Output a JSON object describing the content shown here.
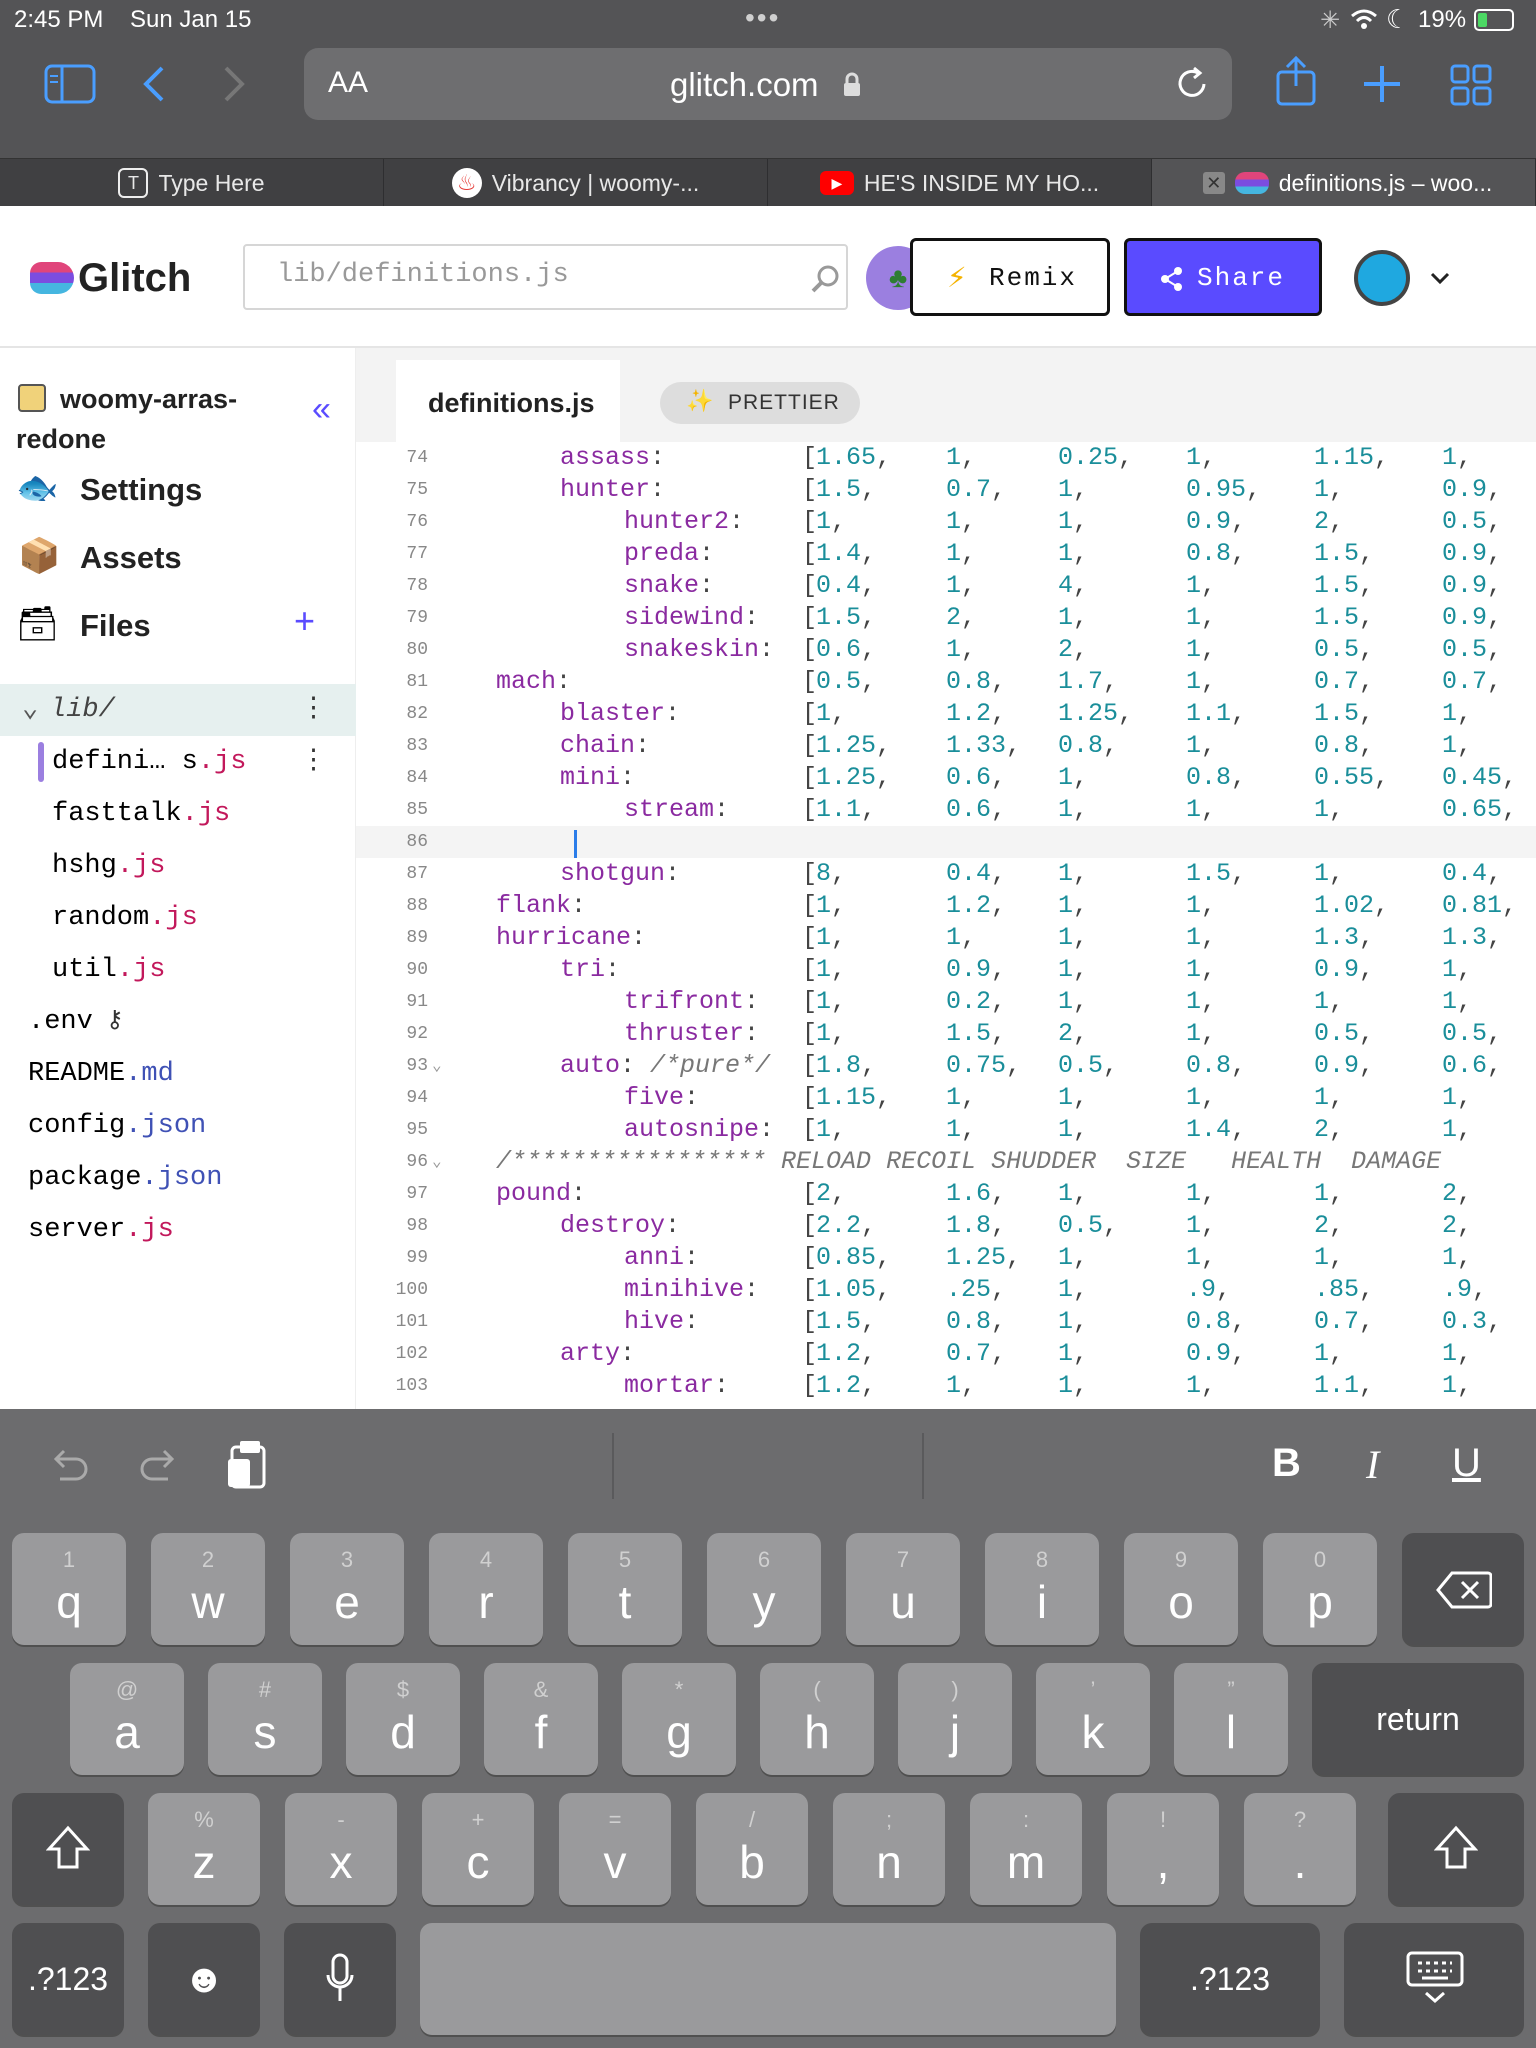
{
  "status": {
    "time": "2:45 PM",
    "date": "Sun Jan 15",
    "battery": "19%"
  },
  "browser": {
    "text_size": "AA",
    "url": "glitch.com"
  },
  "tabs": [
    {
      "title": "Type Here"
    },
    {
      "title": "Vibrancy | woomy-..."
    },
    {
      "title": "HE'S INSIDE MY HO..."
    },
    {
      "title": "definitions.js – woo..."
    }
  ],
  "header": {
    "brand": "Glitch",
    "search_value": "lib/definitions.js",
    "remix_label": "Remix",
    "share_label": "Share"
  },
  "sidebar": {
    "project_line1": "woomy-arras-",
    "project_line2": "redone",
    "settings": "Settings",
    "assets": "Assets",
    "files": "Files",
    "folder": "lib/",
    "files_list": [
      {
        "name": "defini… s",
        "ext": ".js"
      },
      {
        "name": "fasttalk",
        "ext": ".js"
      },
      {
        "name": "hshg",
        "ext": ".js"
      },
      {
        "name": "random",
        "ext": ".js"
      },
      {
        "name": "util",
        "ext": ".js"
      },
      {
        "name": ".env",
        "ext": ""
      },
      {
        "name": "README",
        "ext": ".md"
      },
      {
        "name": "config",
        "ext": ".json"
      },
      {
        "name": "package",
        "ext": ".json"
      },
      {
        "name": "server",
        "ext": ".js"
      }
    ]
  },
  "editor": {
    "tab_label": "definitions.js",
    "prettier_label": "PRETTIER",
    "lines": [
      {
        "n": "74",
        "indent": 2,
        "key": "assass",
        "vals": [
          "1.65",
          "1",
          "0.25",
          "1",
          "1.15",
          "1"
        ]
      },
      {
        "n": "75",
        "indent": 2,
        "key": "hunter",
        "vals": [
          "1.5",
          "0.7",
          "1",
          "0.95",
          "1",
          "0.9"
        ]
      },
      {
        "n": "76",
        "indent": 3,
        "key": "hunter2",
        "vals": [
          "1",
          "1",
          "1",
          "0.9",
          "2",
          "0.5"
        ]
      },
      {
        "n": "77",
        "indent": 3,
        "key": "preda",
        "vals": [
          "1.4",
          "1",
          "1",
          "0.8",
          "1.5",
          "0.9"
        ]
      },
      {
        "n": "78",
        "indent": 3,
        "key": "snake",
        "vals": [
          "0.4",
          "1",
          "4",
          "1",
          "1.5",
          "0.9"
        ]
      },
      {
        "n": "79",
        "indent": 3,
        "key": "sidewind",
        "vals": [
          "1.5",
          "2",
          "1",
          "1",
          "1.5",
          "0.9"
        ]
      },
      {
        "n": "80",
        "indent": 3,
        "key": "snakeskin",
        "vals": [
          "0.6",
          "1",
          "2",
          "1",
          "0.5",
          "0.5"
        ]
      },
      {
        "n": "81",
        "indent": 1,
        "key": "mach",
        "vals": [
          "0.5",
          "0.8",
          "1.7",
          "1",
          "0.7",
          "0.7"
        ]
      },
      {
        "n": "82",
        "indent": 2,
        "key": "blaster",
        "vals": [
          "1",
          "1.2",
          "1.25",
          "1.1",
          "1.5",
          "1"
        ]
      },
      {
        "n": "83",
        "indent": 2,
        "key": "chain",
        "vals": [
          "1.25",
          "1.33",
          "0.8",
          "1",
          "0.8",
          "1"
        ]
      },
      {
        "n": "84",
        "indent": 2,
        "key": "mini",
        "vals": [
          "1.25",
          "0.6",
          "1",
          "0.8",
          "0.55",
          "0.45"
        ]
      },
      {
        "n": "85",
        "indent": 3,
        "key": "stream",
        "vals": [
          "1.1",
          "0.6",
          "1",
          "1",
          "1",
          "0.65"
        ]
      },
      {
        "n": "86",
        "indent": 0,
        "key": "",
        "vals": []
      },
      {
        "n": "87",
        "indent": 2,
        "key": "shotgun",
        "vals": [
          "8",
          "0.4",
          "1",
          "1.5",
          "1",
          "0.4"
        ]
      },
      {
        "n": "88",
        "indent": 1,
        "key": "flank",
        "vals": [
          "1",
          "1.2",
          "1",
          "1",
          "1.02",
          "0.81"
        ]
      },
      {
        "n": "89",
        "indent": 1,
        "key": "hurricane",
        "vals": [
          "1",
          "1",
          "1",
          "1",
          "1.3",
          "1.3"
        ]
      },
      {
        "n": "90",
        "indent": 2,
        "key": "tri",
        "vals": [
          "1",
          "0.9",
          "1",
          "1",
          "0.9",
          "1"
        ]
      },
      {
        "n": "91",
        "indent": 3,
        "key": "trifront",
        "vals": [
          "1",
          "0.2",
          "1",
          "1",
          "1",
          "1"
        ]
      },
      {
        "n": "92",
        "indent": 3,
        "key": "thruster",
        "vals": [
          "1",
          "1.5",
          "2",
          "1",
          "0.5",
          "0.5"
        ]
      },
      {
        "n": "93",
        "indent": 2,
        "key": "auto",
        "comment": "/*pure*/",
        "vals": [
          "1.8",
          "0.75",
          "0.5",
          "0.8",
          "0.9",
          "0.6"
        ]
      },
      {
        "n": "94",
        "indent": 3,
        "key": "five",
        "vals": [
          "1.15",
          "1",
          "1",
          "1",
          "1",
          "1"
        ]
      },
      {
        "n": "95",
        "indent": 3,
        "key": "autosnipe",
        "vals": [
          "1",
          "1",
          "1",
          "1.4",
          "2",
          "1"
        ]
      },
      {
        "n": "96",
        "indent": 1,
        "header": "/***************** RELOAD RECOIL SHUDDER  SIZE   HEALTH  DAMAGE"
      },
      {
        "n": "97",
        "indent": 1,
        "key": "pound",
        "vals": [
          "2",
          "1.6",
          "1",
          "1",
          "1",
          "2"
        ]
      },
      {
        "n": "98",
        "indent": 2,
        "key": "destroy",
        "vals": [
          "2.2",
          "1.8",
          "0.5",
          "1",
          "2",
          "2"
        ]
      },
      {
        "n": "99",
        "indent": 3,
        "key": "anni",
        "vals": [
          "0.85",
          "1.25",
          "1",
          "1",
          "1",
          "1"
        ]
      },
      {
        "n": "100",
        "indent": 3,
        "key": "minihive",
        "vals": [
          "1.05",
          ".25",
          "1",
          ".9",
          ".85",
          ".9"
        ]
      },
      {
        "n": "101",
        "indent": 3,
        "key": "hive",
        "vals": [
          "1.5",
          "0.8",
          "1",
          "0.8",
          "0.7",
          "0.3"
        ]
      },
      {
        "n": "102",
        "indent": 2,
        "key": "arty",
        "vals": [
          "1.2",
          "0.7",
          "1",
          "0.9",
          "1",
          "1"
        ]
      },
      {
        "n": "103",
        "indent": 3,
        "key": "mortar",
        "vals": [
          "1.2",
          "1",
          "1",
          "1",
          "1.1",
          "1"
        ]
      }
    ]
  },
  "keyboard": {
    "row1": [
      [
        "1",
        "q"
      ],
      [
        "2",
        "w"
      ],
      [
        "3",
        "e"
      ],
      [
        "4",
        "r"
      ],
      [
        "5",
        "t"
      ],
      [
        "6",
        "y"
      ],
      [
        "7",
        "u"
      ],
      [
        "8",
        "i"
      ],
      [
        "9",
        "o"
      ],
      [
        "0",
        "p"
      ]
    ],
    "row2": [
      [
        "@",
        "a"
      ],
      [
        "#",
        "s"
      ],
      [
        "$",
        "d"
      ],
      [
        "&",
        "f"
      ],
      [
        "*",
        "g"
      ],
      [
        "(",
        "h"
      ],
      [
        ")",
        "j"
      ],
      [
        "’",
        "k"
      ],
      [
        "”",
        "l"
      ]
    ],
    "row3": [
      [
        "%",
        "z"
      ],
      [
        "-",
        "x"
      ],
      [
        "+",
        "c"
      ],
      [
        "=",
        "v"
      ],
      [
        "/",
        "b"
      ],
      [
        ";",
        "n"
      ],
      [
        ":",
        "m"
      ],
      [
        "!",
        ","
      ],
      [
        "?",
        "."
      ]
    ],
    "return_label": "return",
    "numbers_label": ".?123"
  }
}
